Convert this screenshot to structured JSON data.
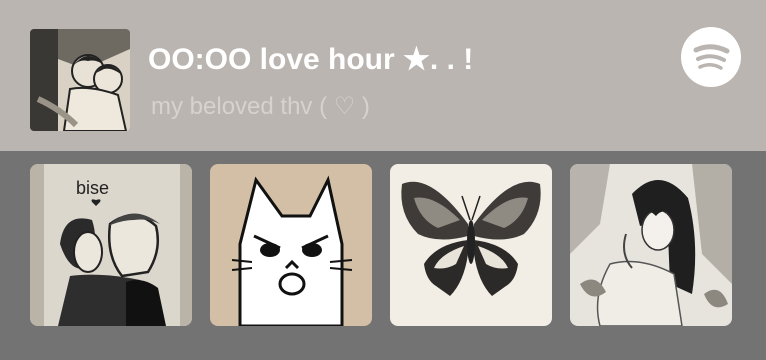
{
  "playlist": {
    "title": "OO:OO love hour ★. . !",
    "subtitle": "my beloved thv ( ♡ )"
  },
  "icons": {
    "spotify": "spotify-logo-icon",
    "cover": "playlist-cover-art"
  },
  "tiles": [
    {
      "name": "manga-kiss-image",
      "caption": "bise"
    },
    {
      "name": "angry-cat-image"
    },
    {
      "name": "butterfly-image"
    },
    {
      "name": "anime-girl-sketch-image"
    }
  ],
  "colors": {
    "header_bg": "#bab5b0",
    "body_bg": "#747373",
    "title": "#ffffff",
    "subtitle": "#d6d2cd"
  }
}
